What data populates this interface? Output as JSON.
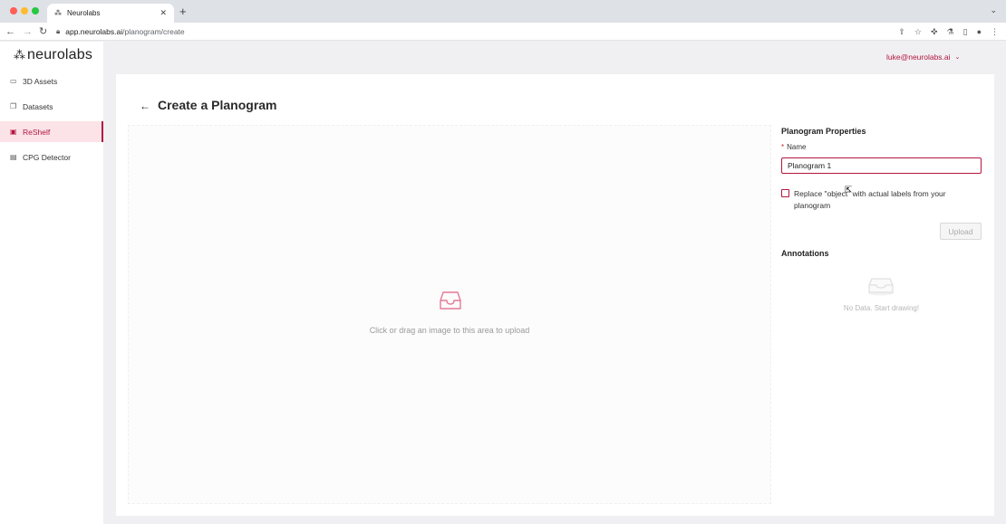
{
  "browser": {
    "tab_title": "Neurolabs",
    "url_host": "app.neurolabs.ai",
    "url_path": "/planogram/create"
  },
  "sidebar": {
    "logo_text": "neurolabs",
    "items": [
      {
        "label": "3D Assets",
        "icon": "folder-icon",
        "active": false
      },
      {
        "label": "Datasets",
        "icon": "copy-icon",
        "active": false
      },
      {
        "label": "ReShelf",
        "icon": "video-icon",
        "active": true
      },
      {
        "label": "CPG Detector",
        "icon": "table-icon",
        "active": false
      }
    ]
  },
  "header": {
    "user_email": "luke@neurolabs.ai"
  },
  "page": {
    "title": "Create a Planogram"
  },
  "dropzone": {
    "text": "Click or drag an image to this area to upload"
  },
  "properties": {
    "title": "Planogram Properties",
    "name_required_mark": "*",
    "name_label": "Name",
    "name_value": "Planogram 1",
    "checkbox_label": "Replace \"object\" with actual labels from your planogram",
    "checkbox_checked": false,
    "upload_label": "Upload"
  },
  "annotations": {
    "title": "Annotations",
    "empty_text": "No Data. Start drawing!"
  },
  "colors": {
    "accent": "#b3163f",
    "active_bg": "#fbe3e8",
    "traffic_red": "#fe5f57",
    "traffic_yellow": "#febc2e",
    "traffic_green": "#28c840"
  }
}
